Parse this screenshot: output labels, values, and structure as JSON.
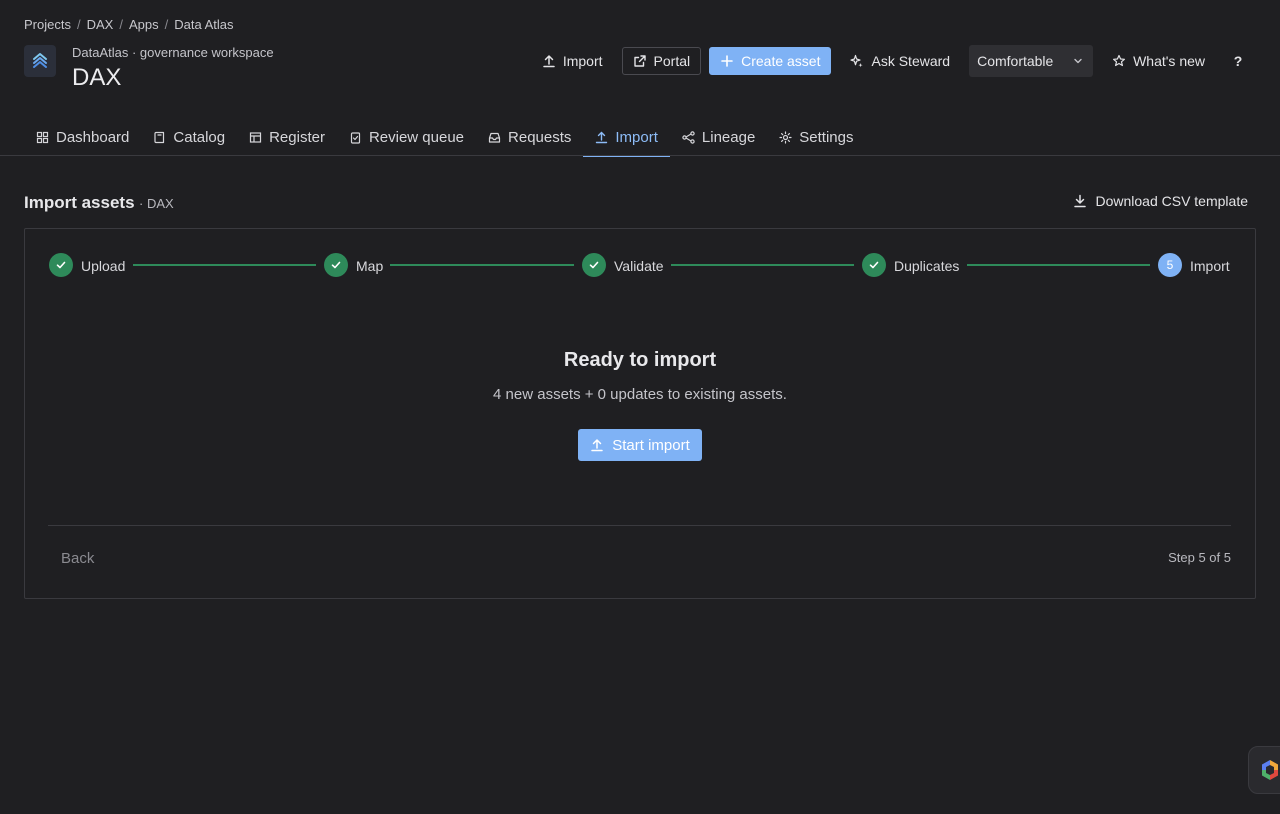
{
  "breadcrumb": [
    {
      "label": "Projects"
    },
    {
      "label": "DAX"
    },
    {
      "label": "Apps"
    },
    {
      "label": "Data Atlas"
    }
  ],
  "breadcrumb_separator": "/",
  "workspace_label": "DataAtlas · governance workspace",
  "page_title": "DAX",
  "header_actions": {
    "import": "Import",
    "portal": "Portal",
    "create_asset": "Create asset",
    "ask_steward": "Ask Steward",
    "density_select": "Comfortable",
    "whats_new": "What's new",
    "help": "?"
  },
  "tabs": [
    {
      "label": "Dashboard",
      "icon": "dashboard-icon"
    },
    {
      "label": "Catalog",
      "icon": "book-icon"
    },
    {
      "label": "Register",
      "icon": "table-icon"
    },
    {
      "label": "Review queue",
      "icon": "clipboard-check-icon"
    },
    {
      "label": "Requests",
      "icon": "inbox-icon"
    },
    {
      "label": "Import",
      "icon": "upload-icon",
      "active": true
    },
    {
      "label": "Lineage",
      "icon": "lineage-icon"
    },
    {
      "label": "Settings",
      "icon": "gear-icon"
    }
  ],
  "section": {
    "title": "Import assets",
    "subtitle": "· DAX",
    "download_template": "Download CSV template"
  },
  "stepper": {
    "steps": [
      {
        "label": "Upload",
        "status": "complete"
      },
      {
        "label": "Map",
        "status": "complete"
      },
      {
        "label": "Validate",
        "status": "complete"
      },
      {
        "label": "Duplicates",
        "status": "complete"
      },
      {
        "label": "Import",
        "status": "current",
        "number": "5"
      }
    ]
  },
  "ready": {
    "title": "Ready to import",
    "description": "4 new assets + 0 updates to existing assets.",
    "start_button": "Start import"
  },
  "footer": {
    "back": "Back",
    "step_count": "Step 5 of 5"
  },
  "colors": {
    "background": "#1f1f22",
    "accent": "#7fb2f5",
    "success": "#2e8a5a",
    "border": "#3a3a3f"
  }
}
